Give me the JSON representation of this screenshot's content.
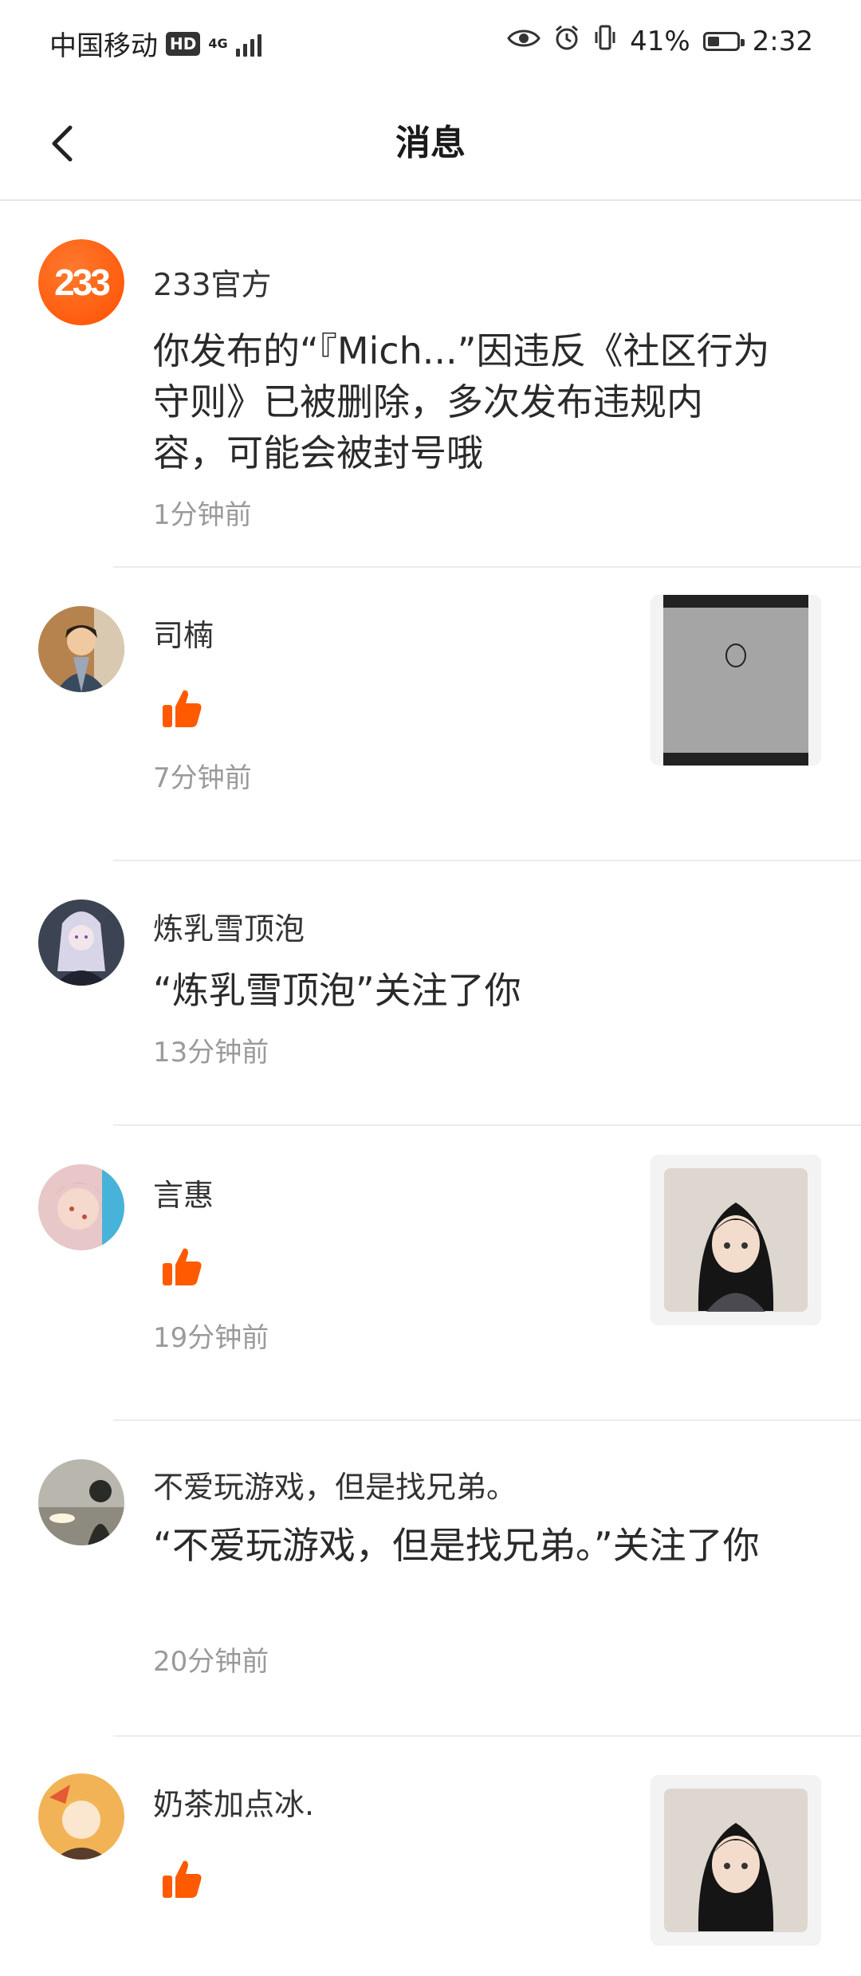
{
  "status_bar": {
    "carrier": "中国移动",
    "hd": "HD",
    "network": "4G",
    "battery_percent": "41%",
    "battery_level": 0.41,
    "time": "2:32",
    "icons": [
      "eye-icon",
      "alarm-icon",
      "vibrate-icon",
      "battery-icon"
    ]
  },
  "header": {
    "title": "消息",
    "back_icon": "chevron-left-icon"
  },
  "messages": [
    {
      "name": "233官方",
      "avatar_text": "233",
      "content": "你发布的“『Mich...”因违反《社区行为守则》已被删除，多次发布违规内容，可能会被封号哦",
      "time": "1分钟前"
    },
    {
      "name": "司楠",
      "type": "like",
      "time": "7分钟前"
    },
    {
      "name": "炼乳雪顶泡",
      "content": "“炼乳雪顶泡”关注了你",
      "time": "13分钟前"
    },
    {
      "name": "言惠",
      "type": "like",
      "time": "19分钟前"
    },
    {
      "name": "不爱玩游戏，但是找兄弟。",
      "content": "“不爱玩游戏，但是找兄弟。”关注了你",
      "time": "20分钟前"
    },
    {
      "name": "奶茶加点冰.",
      "type": "like",
      "time": ""
    }
  ],
  "colors": {
    "accent": "#ff5a00",
    "time_text": "#9a9a9a",
    "divider": "#ececec"
  }
}
